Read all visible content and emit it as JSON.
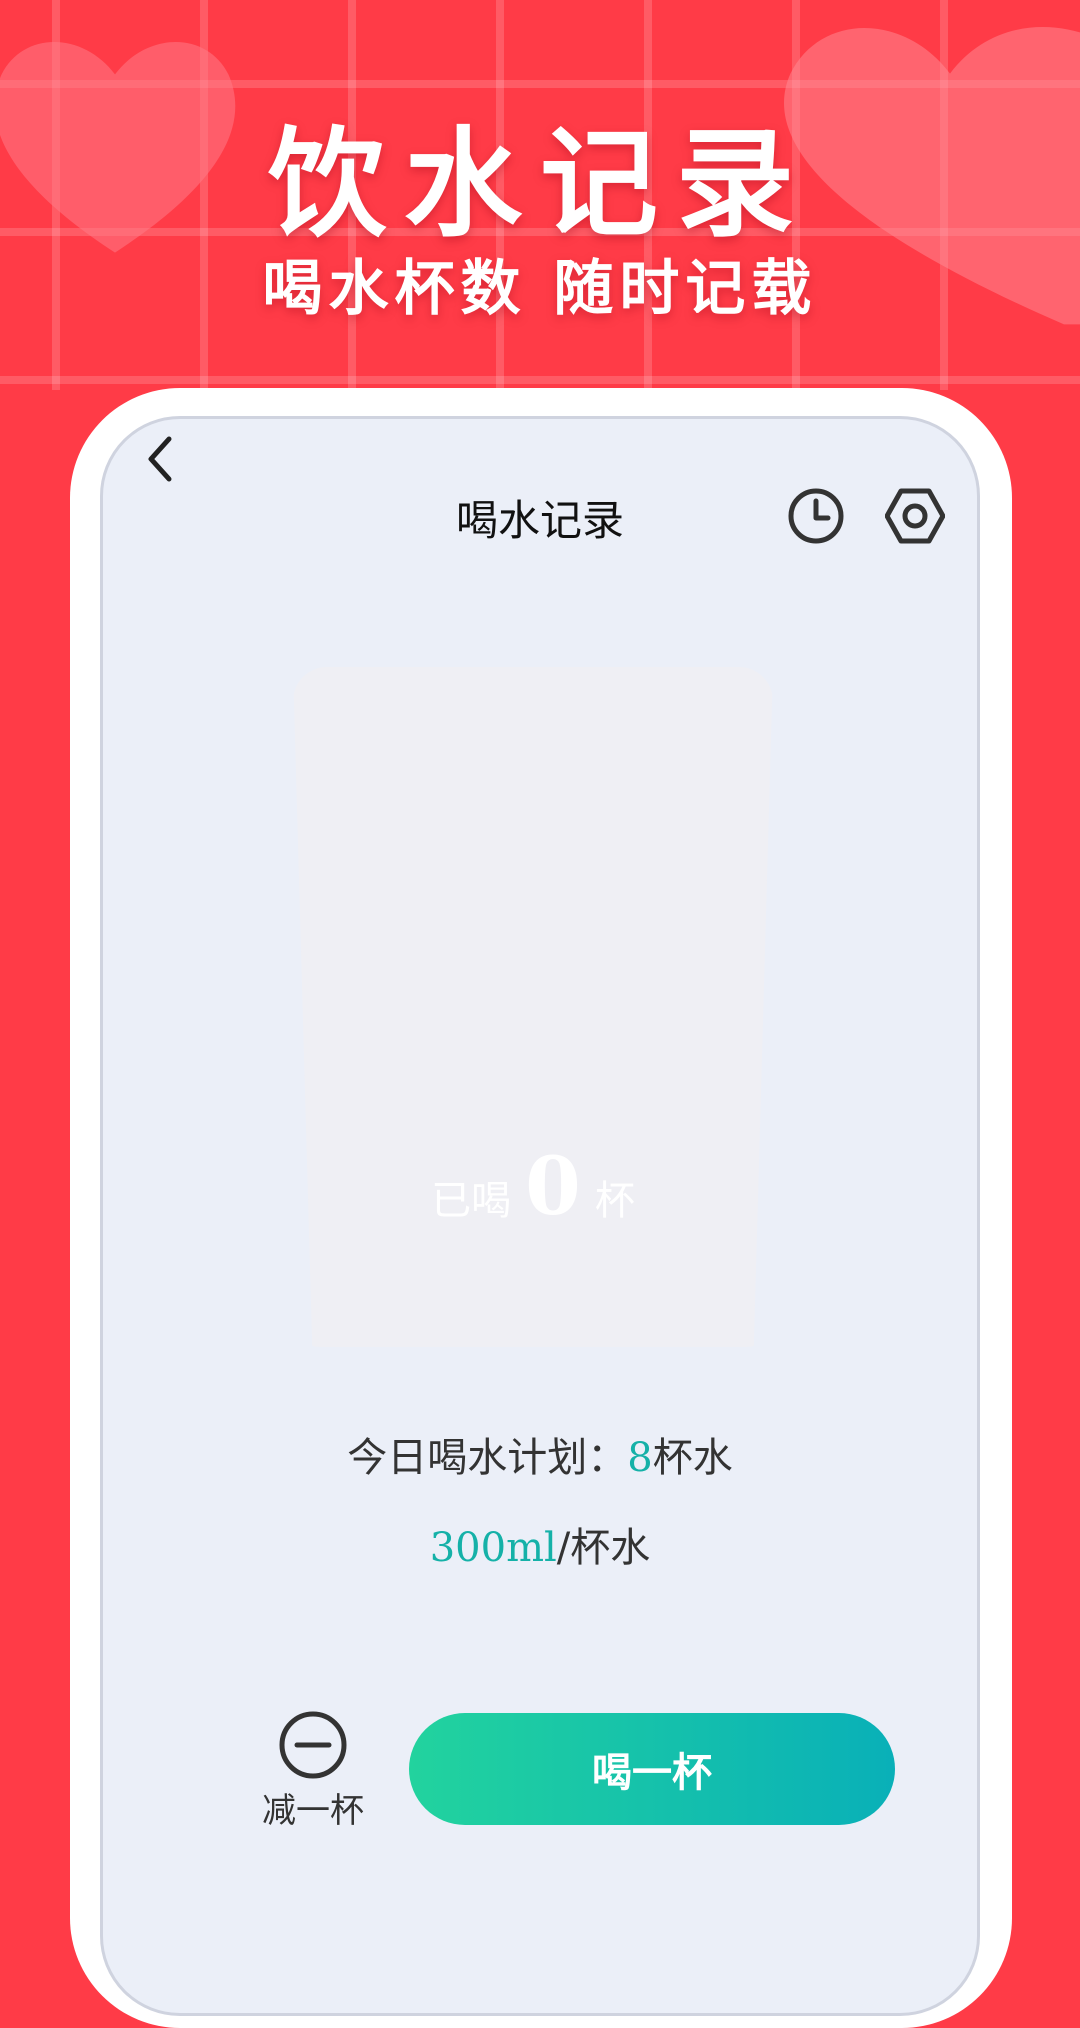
{
  "banner": {
    "title": "饮水记录",
    "subtitle": "喝水杯数 随时记载"
  },
  "app": {
    "title": "喝水记录",
    "icons": {
      "back": "chevron-left-icon",
      "history": "clock-icon",
      "settings": "gear-icon"
    }
  },
  "progress": {
    "prefix": "已喝",
    "count": "0",
    "unit": "杯"
  },
  "plan": {
    "label": "今日喝水计划：",
    "cups": "8",
    "cups_unit": "杯水",
    "volume": "300ml",
    "volume_unit": "/杯水"
  },
  "actions": {
    "minus_label": "减一杯",
    "drink_label": "喝一杯"
  },
  "colors": {
    "background": "#ff3b47",
    "accent_teal": "#15b1a8",
    "button_gradient_start": "#22d39e",
    "button_gradient_end": "#09b0b8"
  }
}
